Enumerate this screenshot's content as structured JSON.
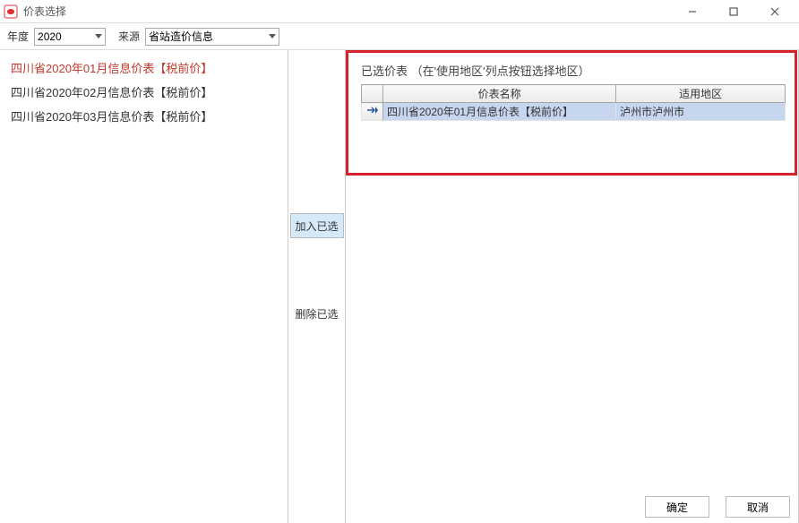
{
  "window": {
    "title": "价表选择"
  },
  "toolbar": {
    "year_label": "年度",
    "year_value": "2020",
    "source_label": "来源",
    "source_value": "省站造价信息"
  },
  "left_list": {
    "items": [
      {
        "label": "四川省2020年01月信息价表【税前价】",
        "selected": true
      },
      {
        "label": "四川省2020年02月信息价表【税前价】",
        "selected": false
      },
      {
        "label": "四川省2020年03月信息价表【税前价】",
        "selected": false
      }
    ]
  },
  "middle": {
    "add_label": "加入已选",
    "remove_label": "删除已选"
  },
  "right": {
    "title": "已选价表 （在'使用地区'列点按钮选择地区）",
    "columns": {
      "name": "价表名称",
      "region": "适用地区"
    },
    "rows": [
      {
        "name": "四川省2020年01月信息价表【税前价】",
        "region": "泸州市泸州市"
      }
    ]
  },
  "footer": {
    "ok": "确定",
    "cancel": "取消"
  }
}
